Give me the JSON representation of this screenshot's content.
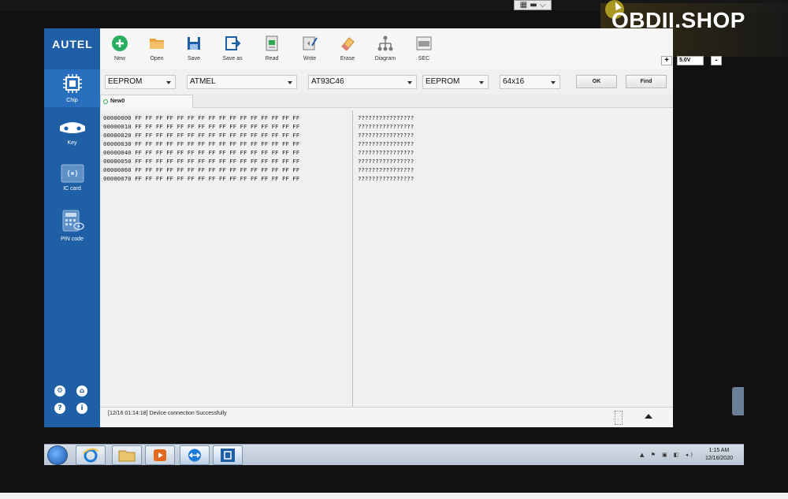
{
  "remote_control": {
    "label": "▦ ▬ ⌵"
  },
  "watermark": {
    "text": "OBDII.SHOP"
  },
  "app": {
    "brand": "AUTEL",
    "sidebar": {
      "items": [
        {
          "label": "Chip",
          "icon": "chip-icon",
          "active": true
        },
        {
          "label": "Key",
          "icon": "key-icon",
          "active": false
        },
        {
          "label": "IC card",
          "icon": "ic-card-icon",
          "active": false
        },
        {
          "label": "PIN code",
          "icon": "pin-code-icon",
          "active": false
        }
      ],
      "bottom_icons": {
        "settings": "⚙",
        "home": "⌂",
        "help": "?",
        "info": "i"
      }
    },
    "toolbar": {
      "items": [
        {
          "label": "New",
          "icon": "new-icon",
          "color": "#27ae60"
        },
        {
          "label": "Open",
          "icon": "open-folder-icon",
          "color": "#e8a33d"
        },
        {
          "label": "Save",
          "icon": "save-icon",
          "color": "#1f5fa6"
        },
        {
          "label": "Save as",
          "icon": "save-as-icon",
          "color": "#1f5fa6"
        },
        {
          "label": "Read",
          "icon": "read-icon",
          "color": "#7a7a7a"
        },
        {
          "label": "Write",
          "icon": "write-icon",
          "color": "#7a7a7a"
        },
        {
          "label": "Erase",
          "icon": "erase-icon",
          "color": "#e8a33d"
        },
        {
          "label": "Diagram",
          "icon": "diagram-icon",
          "color": "#7a7a7a"
        },
        {
          "label": "SEC",
          "icon": "sec-icon",
          "color": "#7a7a7a"
        }
      ],
      "voltage": {
        "plus": "+",
        "value": "5.0V",
        "minus": "-"
      }
    },
    "filters": {
      "memory_type": "EEPROM",
      "manufacturer": "ATMEL",
      "chip_model": "AT93C46",
      "chip_type": "EEPROM",
      "organization": "64x16",
      "ok_label": "OK",
      "find_label": "Find"
    },
    "tabs": [
      {
        "label": "New0"
      }
    ],
    "hex": {
      "rows": [
        {
          "addr": "00000000",
          "bytes": "FF FF FF FF FF FF FF FF FF FF FF FF FF FF FF FF",
          "ascii": "????????????????"
        },
        {
          "addr": "00000010",
          "bytes": "FF FF FF FF FF FF FF FF FF FF FF FF FF FF FF FF",
          "ascii": "????????????????"
        },
        {
          "addr": "00000020",
          "bytes": "FF FF FF FF FF FF FF FF FF FF FF FF FF FF FF FF",
          "ascii": "????????????????"
        },
        {
          "addr": "00000030",
          "bytes": "FF FF FF FF FF FF FF FF FF FF FF FF FF FF FF FF",
          "ascii": "????????????????"
        },
        {
          "addr": "00000040",
          "bytes": "FF FF FF FF FF FF FF FF FF FF FF FF FF FF FF FF",
          "ascii": "????????????????"
        },
        {
          "addr": "00000050",
          "bytes": "FF FF FF FF FF FF FF FF FF FF FF FF FF FF FF FF",
          "ascii": "????????????????"
        },
        {
          "addr": "00000060",
          "bytes": "FF FF FF FF FF FF FF FF FF FF FF FF FF FF FF FF",
          "ascii": "????????????????"
        },
        {
          "addr": "00000070",
          "bytes": "FF FF FF FF FF FF FF FF FF FF FF FF FF FF FF FF",
          "ascii": "????????????????"
        }
      ]
    },
    "status": {
      "message": "[12/16 01:14:18] Device connection Successfully"
    }
  },
  "taskbar": {
    "buttons": [
      {
        "name": "internet-explorer",
        "icon": "ie-icon"
      },
      {
        "name": "file-explorer",
        "icon": "folder-icon"
      },
      {
        "name": "media-player",
        "icon": "media-player-icon"
      },
      {
        "name": "teamviewer",
        "icon": "teamviewer-icon"
      },
      {
        "name": "autel-app",
        "icon": "chip-app-icon"
      }
    ],
    "tray_icons": "▲ ⚑ ▣ ◧ ◂)",
    "time": "1:15 AM",
    "date": "12/16/2020"
  }
}
